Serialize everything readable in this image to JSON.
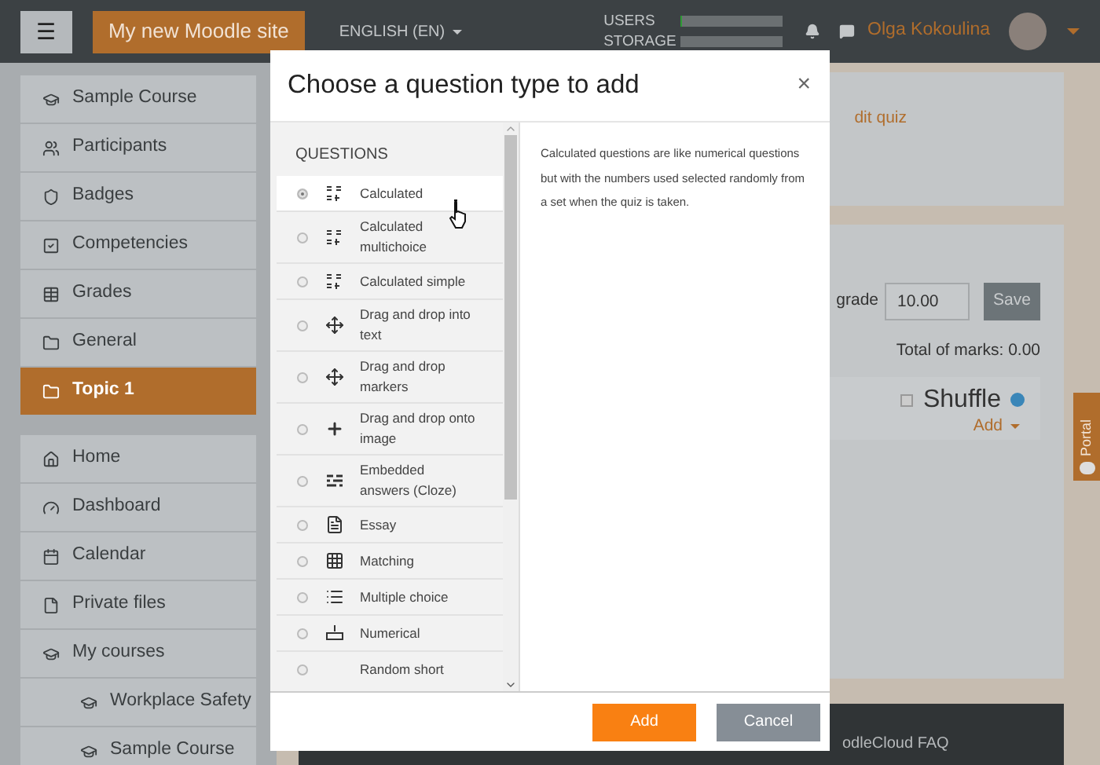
{
  "header": {
    "menu_button": "☰",
    "site_name": "My new Moodle site",
    "language": "ENGLISH (EN)",
    "usage": [
      {
        "label": "USERS",
        "level": 0.01
      },
      {
        "label": "STORAGE"
      }
    ],
    "user_name": "Olga Kokoulina"
  },
  "sidebar": {
    "groups": [
      [
        {
          "label": "Sample Course",
          "selected": false
        },
        {
          "label": "Participants",
          "selected": false
        },
        {
          "label": "Badges",
          "selected": false
        },
        {
          "label": "Competencies",
          "selected": false
        },
        {
          "label": "Grades",
          "selected": false
        },
        {
          "label": "General",
          "selected": false
        },
        {
          "label": "Topic 1",
          "selected": true
        }
      ],
      [
        {
          "label": "Home",
          "selected": false
        },
        {
          "label": "Dashboard",
          "selected": false
        },
        {
          "label": "Calendar",
          "selected": false
        },
        {
          "label": "Private files",
          "selected": false
        },
        {
          "label": "My courses",
          "selected": false,
          "children": [
            {
              "label": "Workplace Safety",
              "selected": false
            },
            {
              "label": "Sample Course",
              "selected": false
            }
          ]
        }
      ]
    ]
  },
  "main": {
    "edit_link": "dit quiz",
    "grade_label": "grade",
    "grade_value": "10.00",
    "save_button": "Save",
    "total": "Total of marks: 0.00",
    "shuffle": {
      "label": "Shuffle",
      "checked": false
    },
    "add_menu": "Add",
    "footer_link": "odleCloud FAQ",
    "portal_tab": "Portal"
  },
  "dialog": {
    "title": "Choose a question type to add",
    "close": "×",
    "section": "QUESTIONS",
    "items": [
      {
        "label": "Calculated",
        "kind": "calc",
        "selected": true
      },
      {
        "label": "Calculated multichoice",
        "kind": "calc",
        "selected": false
      },
      {
        "label": "Calculated simple",
        "kind": "calc",
        "selected": false
      },
      {
        "label": "Drag and drop into text",
        "kind": "move",
        "selected": false
      },
      {
        "label": "Drag and drop markers",
        "kind": "markers",
        "selected": false
      },
      {
        "label": "Drag and drop onto image",
        "kind": "cross",
        "selected": false
      },
      {
        "label": "Embedded answers (Cloze)",
        "kind": "cloze",
        "selected": false
      },
      {
        "label": "Essay",
        "kind": "essay",
        "selected": false
      },
      {
        "label": "Matching",
        "kind": "grid",
        "selected": false
      },
      {
        "label": "Multiple choice",
        "kind": "list",
        "selected": false
      },
      {
        "label": "Numerical",
        "kind": "numeric",
        "selected": false
      },
      {
        "label": "Random short",
        "kind": "none",
        "selected": false
      }
    ],
    "description": "Calculated questions are like numerical questions but with the numbers used selected randomly from a set when the quiz is taken.",
    "buttons": [
      {
        "label": "Add",
        "kind": "primary"
      },
      {
        "label": "Cancel",
        "kind": "secondary"
      }
    ]
  }
}
